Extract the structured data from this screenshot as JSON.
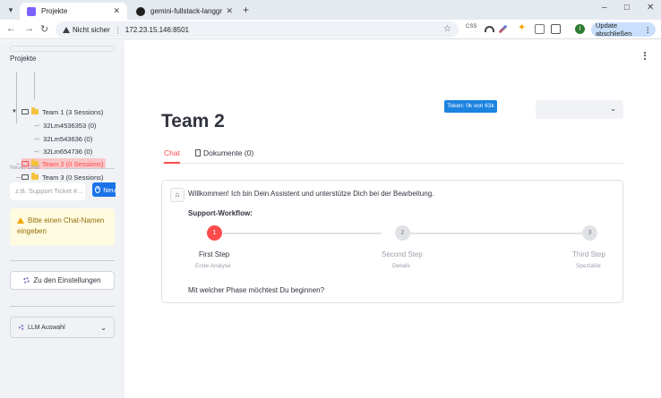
{
  "browser": {
    "tabs": [
      {
        "title": "Projekte",
        "active": true
      },
      {
        "title": "gemini-fullstack-langgraph-qui",
        "active": false
      }
    ],
    "new_tab": "+",
    "window_controls": [
      "–",
      "□",
      "✕"
    ],
    "security_label": "Nicht sicher",
    "url": "172.23.15.146:8501",
    "update_button": "Update abschließen",
    "profile_initial": "I"
  },
  "sidebar": {
    "projects_heading": "Projekte",
    "tree": [
      {
        "label": "Team 1 (3 Sessions)",
        "level": 0,
        "selected": false
      },
      {
        "label": "32Lm4536353 (0)",
        "level": 1,
        "selected": false
      },
      {
        "label": "32Lm543636 (0)",
        "level": 1,
        "selected": false
      },
      {
        "label": "32Lm654736 (0)",
        "level": 1,
        "selected": false
      },
      {
        "label": "Team 2 (0 Sessions)",
        "level": 0,
        "selected": true
      },
      {
        "label": "Team 3 (0 Sessions)",
        "level": 0,
        "selected": false
      }
    ],
    "new_chat_label": "Neuer Chat",
    "new_chat_placeholder": "z.B. Support Ticket #...",
    "new_chat_button": "Neu",
    "warning": "Bitte einen Chat-Namen eingeben",
    "settings_button": "Zu den Einstellungen",
    "llm_select": "LLM Auswahl"
  },
  "main": {
    "title": "Team 2",
    "token_badge": "Token: 0k von 63k",
    "tabs": [
      {
        "label": "Chat",
        "active": true
      },
      {
        "label": "Dokumente (0)",
        "active": false
      }
    ],
    "message": {
      "welcome": "Willkommen! Ich bin Dein Assistent und unterstütze Dich bei der Bearbeitung.",
      "workflow_title": "Support-Workflow:",
      "steps": [
        {
          "number": "1",
          "name": "First Step",
          "sub": "Erste Analyse",
          "active": true
        },
        {
          "number": "2",
          "name": "Second Step",
          "sub": "Details",
          "active": false
        },
        {
          "number": "3",
          "name": "Third Step",
          "sub": "Spezialist",
          "active": false
        }
      ],
      "question": "Mit welcher Phase möchtest Du beginnen?"
    }
  },
  "colors": {
    "accent": "#ff4b4b",
    "primary_blue": "#1c83e1",
    "sidebar_bg": "#f0f2f6",
    "warning_bg": "#fffbe1"
  }
}
